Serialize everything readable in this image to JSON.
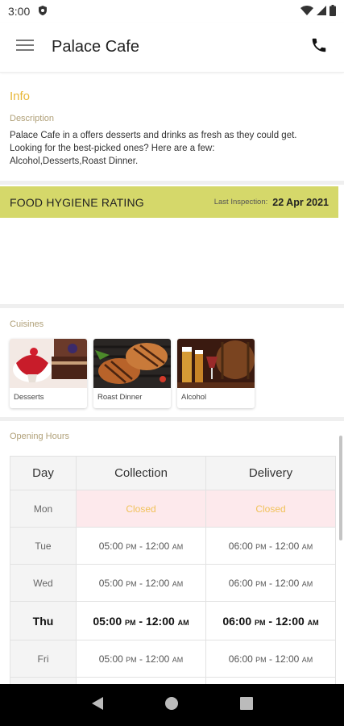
{
  "status_bar": {
    "time": "3:00"
  },
  "app_bar": {
    "title": "Palace Cafe"
  },
  "info": {
    "title": "Info",
    "description_label": "Description",
    "description": "Palace Cafe in a offers desserts and drinks as fresh as they could get. Looking for the best-picked ones? Here are a few: Alcohol,Desserts,Roast Dinner."
  },
  "hygiene": {
    "label": "FOOD HYGIENE RATING",
    "inspection_label": "Last Inspection:",
    "inspection_date": "22 Apr 2021"
  },
  "cuisines": {
    "label": "Cuisines",
    "items": [
      {
        "name": "Desserts"
      },
      {
        "name": "Roast Dinner"
      },
      {
        "name": "Alcohol"
      }
    ]
  },
  "opening_hours": {
    "label": "Opening Hours",
    "headers": {
      "day": "Day",
      "collection": "Collection",
      "delivery": "Delivery"
    },
    "rows": [
      {
        "day": "Mon",
        "collection": "Closed",
        "delivery": "Closed"
      },
      {
        "day": "Tue",
        "collection_open": "05:00",
        "collection_close": "12:00",
        "delivery_open": "06:00",
        "delivery_close": "12:00"
      },
      {
        "day": "Wed",
        "collection_open": "05:00",
        "collection_close": "12:00",
        "delivery_open": "06:00",
        "delivery_close": "12:00"
      },
      {
        "day": "Thu",
        "collection_open": "05:00",
        "collection_close": "12:00",
        "delivery_open": "06:00",
        "delivery_close": "12:00"
      },
      {
        "day": "Fri",
        "collection_open": "05:00",
        "collection_close": "12:00",
        "delivery_open": "06:00",
        "delivery_close": "12:00"
      }
    ],
    "pm": "PM",
    "am": "AM",
    "dash": " - "
  },
  "colors": {
    "accent": "#e8b83a",
    "hygiene_bar": "#d5d86a",
    "closed_bg": "#fde9ec"
  },
  "icons": [
    "menu-icon",
    "phone-icon",
    "shield-icon",
    "wifi-icon",
    "signal-icon",
    "battery-icon",
    "back-icon",
    "home-icon",
    "recents-icon"
  ]
}
